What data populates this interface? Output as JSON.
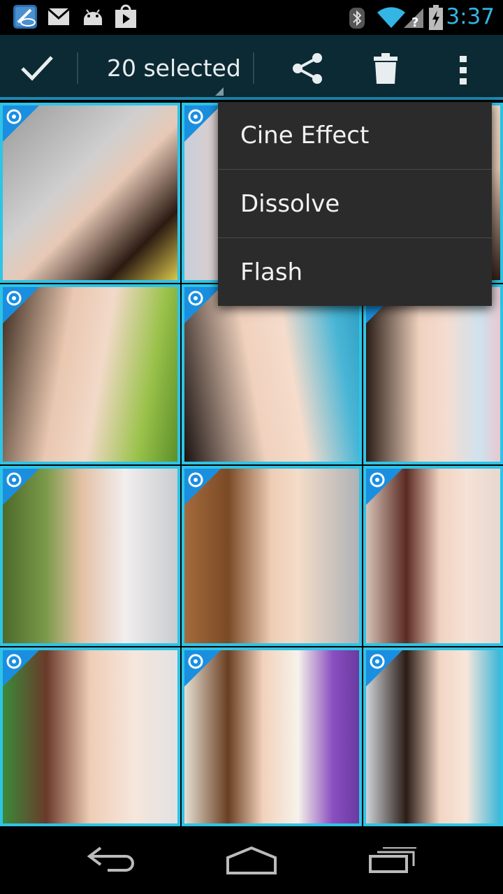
{
  "status_bar": {
    "time": "3:37",
    "left_icons": [
      "intel-app-icon",
      "gmail-icon",
      "android-debug-icon",
      "play-store-icon"
    ],
    "right_icons": [
      "bluetooth-icon",
      "wifi-icon",
      "signal-icon",
      "battery-charging-icon"
    ],
    "accent_color": "#33b5e5"
  },
  "action_bar": {
    "done_icon": "check-icon",
    "selection_title": "20 selected",
    "actions": [
      {
        "name": "share",
        "icon": "share-icon"
      },
      {
        "name": "delete",
        "icon": "trash-icon"
      },
      {
        "name": "overflow",
        "icon": "overflow-icon"
      }
    ],
    "background_color": "#0c2a33"
  },
  "grid": {
    "selected_border_color": "#2ec4e6",
    "badge_icon": "camera-badge-icon",
    "tiles": [
      {
        "name": "photo-1",
        "selected": true
      },
      {
        "name": "photo-2",
        "selected": true
      },
      {
        "name": "photo-3",
        "selected": true
      },
      {
        "name": "photo-4",
        "selected": true
      },
      {
        "name": "photo-5",
        "selected": true
      },
      {
        "name": "photo-6",
        "selected": true
      },
      {
        "name": "photo-7",
        "selected": true
      },
      {
        "name": "photo-8",
        "selected": true
      },
      {
        "name": "photo-9",
        "selected": true
      },
      {
        "name": "photo-10",
        "selected": true
      },
      {
        "name": "photo-11",
        "selected": true
      },
      {
        "name": "photo-12",
        "selected": true
      }
    ]
  },
  "popup_menu": {
    "items": [
      {
        "label": "Cine Effect"
      },
      {
        "label": "Dissolve"
      },
      {
        "label": "Flash"
      }
    ]
  },
  "nav_bar": {
    "buttons": [
      {
        "name": "back",
        "icon": "back-icon"
      },
      {
        "name": "home",
        "icon": "home-icon"
      },
      {
        "name": "recents",
        "icon": "recents-icon"
      }
    ]
  }
}
